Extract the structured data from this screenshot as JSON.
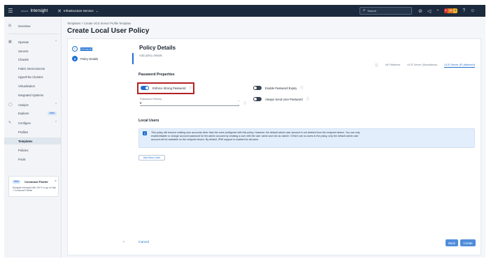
{
  "topbar": {
    "menu_icon": "hamburger-icon",
    "logo": "cisco",
    "brand": "Intersight",
    "service": "Infrastructure Service",
    "service_icon": "infrastructure-icon",
    "search_placeholder": "Search",
    "alert_badge_red": "6",
    "alert_badge_orange": "16",
    "alert_badge_yellow": "4",
    "colors": {
      "bar": "#1c2a3d",
      "accent": "#1f6fd1"
    }
  },
  "sidebar": {
    "overview": "Overview",
    "operate": "Operate",
    "operate_items": [
      "Servers",
      "Chassis",
      "Fabric Interconnects",
      "HyperFlex Clusters",
      "Virtualization",
      "Integrated Systems"
    ],
    "analyze": "Analyze",
    "explorer": "Explorer",
    "explorer_badge": "New",
    "configure": "Configure",
    "configure_items": [
      "Profiles",
      "Templates",
      "Policies",
      "Pools"
    ],
    "palette": {
      "tag": "New",
      "title": "Command Palette",
      "text": "Navigate Intersight with Ctrl+K or go to Help > Command Palette"
    }
  },
  "main": {
    "breadcrumb": "Templates  >  Create UCS Server Profile Template",
    "title": "Create Local User Policy",
    "steps": [
      {
        "num": "✓",
        "label": "General"
      },
      {
        "num": "2",
        "label": "Policy Details"
      }
    ],
    "details_title": "Policy Details",
    "details_sub": "Add policy details",
    "platform_tabs": [
      "All Platforms",
      "UCS Server (Standalone)",
      "UCS Server (FI-Attached)"
    ],
    "password_props_title": "Password Properties",
    "enforce_strong": "Enforce Strong Password",
    "enable_expiry": "Enable Password Expiry",
    "always_send": "Always Send User Password",
    "history_label": "Password History",
    "history_value": "5",
    "history_range": "0 - 5",
    "local_users_title": "Local Users",
    "banner_text": "This policy will remove existing user accounts other than the ones configured with this policy. However, the default admin user account is not deleted from the endpoint device. You can only enable/disable or change account password for the admin account by creating a user with the user name and role as 'admin'. If there are no users in the policy, only the default admin user account will be available on the endpoint device. By default, IPMI support is enabled for all users.",
    "add_user": "Add New User",
    "cancel": "Cancel",
    "back": "Back",
    "create": "Create"
  }
}
